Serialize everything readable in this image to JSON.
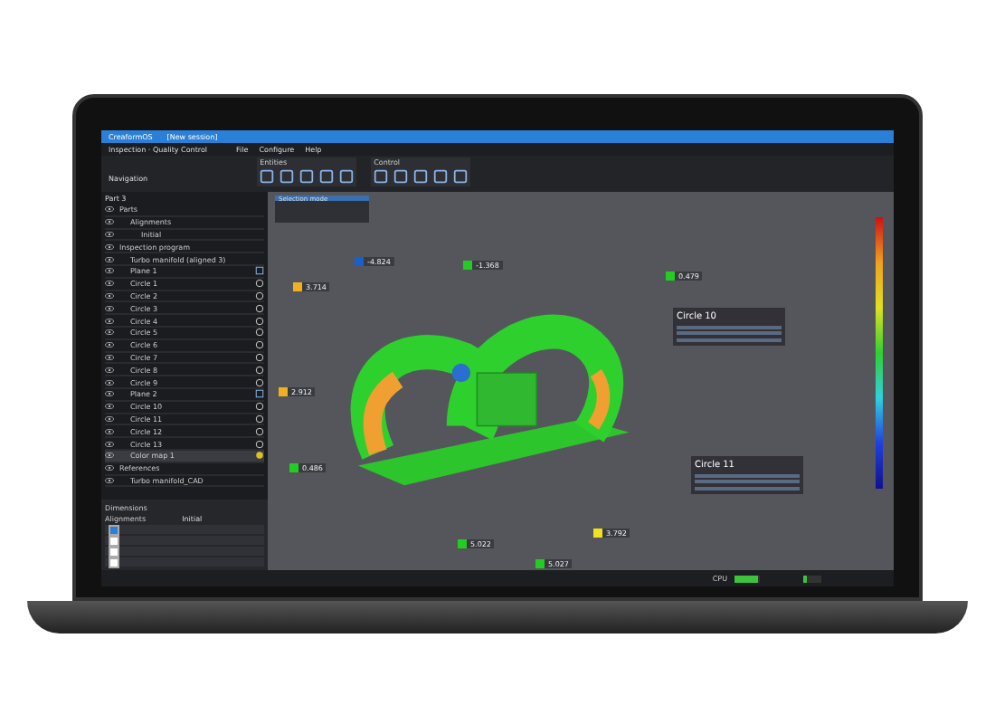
{
  "window": {
    "title": "CreaformOS",
    "session": "[New session]"
  },
  "nav": {
    "breadcrumb": "Inspection · Quality Control"
  },
  "menu": [
    "File",
    "Configure",
    "Help"
  ],
  "toolbar": {
    "groups": [
      "Entities",
      "Control"
    ]
  },
  "navigation": {
    "title": "Navigation",
    "part": "Part 3",
    "tree": [
      {
        "label": "Parts",
        "children": [
          {
            "label": "Alignments",
            "children": [
              {
                "label": "Initial"
              }
            ]
          }
        ]
      },
      {
        "label": "Inspection program",
        "children": [
          {
            "label": "Turbo manifold (aligned 3)",
            "kind": "mesh",
            "selected": false
          },
          {
            "label": "Plane 1",
            "kind": "plane",
            "selected": false
          },
          {
            "label": "Circle 1",
            "kind": "circle",
            "selected": false
          },
          {
            "label": "Circle 2",
            "kind": "circle",
            "selected": false
          },
          {
            "label": "Circle 3",
            "kind": "circle",
            "selected": false
          },
          {
            "label": "Circle 4",
            "kind": "circle",
            "selected": false
          },
          {
            "label": "Circle 5",
            "kind": "circle",
            "selected": false
          },
          {
            "label": "Circle 6",
            "kind": "circle",
            "selected": false
          },
          {
            "label": "Circle 7",
            "kind": "circle",
            "selected": false
          },
          {
            "label": "Circle 8",
            "kind": "circle",
            "selected": false
          },
          {
            "label": "Circle 9",
            "kind": "circle",
            "selected": false
          },
          {
            "label": "Plane 2",
            "kind": "plane",
            "selected": false
          },
          {
            "label": "Circle 10",
            "kind": "circle",
            "selected": false
          },
          {
            "label": "Circle 11",
            "kind": "circle",
            "selected": false
          },
          {
            "label": "Circle 12",
            "kind": "circle",
            "selected": false
          },
          {
            "label": "Circle 13",
            "kind": "circle",
            "selected": false
          },
          {
            "label": "Color map 1",
            "kind": "colormap",
            "selected": true
          }
        ]
      },
      {
        "label": "References",
        "children": [
          {
            "label": "Turbo manifold_CAD",
            "kind": "mesh",
            "selected": false
          }
        ]
      }
    ]
  },
  "dimensions": {
    "title": "Dimensions",
    "alignment_label": "Alignments",
    "alignment_value": "Initial",
    "rows": [
      {
        "checked": true
      },
      {
        "checked": false
      },
      {
        "checked": false
      },
      {
        "checked": false
      }
    ]
  },
  "viewport": {
    "toolbar_title": "Selection mode",
    "callouts": [
      {
        "value": "-4.824",
        "color": "#1a5fd0"
      },
      {
        "value": "-1.368",
        "color": "#22cc22"
      },
      {
        "value": "0.479",
        "color": "#22cc22"
      },
      {
        "value": "3.714",
        "color": "#f0b020"
      },
      {
        "value": "2.912",
        "color": "#f0b020"
      },
      {
        "value": "0.486",
        "color": "#22cc22"
      },
      {
        "value": "5.022",
        "color": "#22cc22"
      },
      {
        "value": "3.792",
        "color": "#f0e020"
      },
      {
        "value": "5.027",
        "color": "#22cc22"
      }
    ],
    "panels": [
      {
        "title": "Circle 10"
      },
      {
        "title": "Circle 11"
      }
    ]
  },
  "status_bar": {
    "cpu_label": "CPU",
    "cpu": {
      "level": 0.9
    },
    "mem": {
      "level": 0.2
    }
  }
}
